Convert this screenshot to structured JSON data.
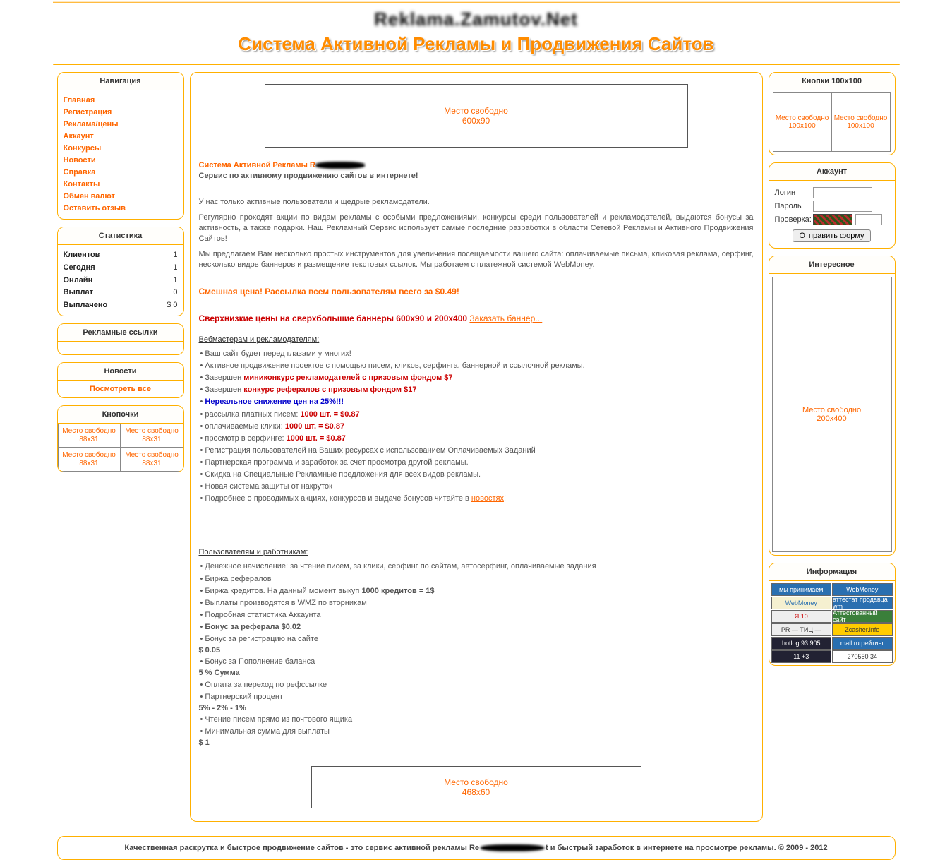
{
  "header": {
    "site_title": "Reklama.Zamutov.Net",
    "subtitle": "Система Активной Рекламы и Продвижения Сайтов"
  },
  "nav": {
    "title": "Навигация",
    "items": [
      "Главная",
      "Регистрация",
      "Реклама/цены",
      "Аккаунт",
      "Конкурсы",
      "Новости",
      "Справка",
      "Контакты",
      "Обмен валют",
      "Оставить отзыв"
    ]
  },
  "stats": {
    "title": "Статистика",
    "rows": [
      {
        "label": "Клиентов",
        "value": "1"
      },
      {
        "label": "Сегодня",
        "value": "1"
      },
      {
        "label": "Онлайн",
        "value": "1"
      },
      {
        "label": "Выплат",
        "value": "0"
      },
      {
        "label": "Выплачено",
        "value": "$ 0"
      }
    ]
  },
  "adlinks": {
    "title": "Рекламные ссылки"
  },
  "news": {
    "title": "Новости",
    "link": "Посмотреть все"
  },
  "buttons88": {
    "title": "Кнопочки",
    "slot": "Место свободно 88x31"
  },
  "banner600": {
    "line1": "Место свободно",
    "line2": "600x90"
  },
  "banner468": {
    "line1": "Место свободно",
    "line2": "468x60"
  },
  "main": {
    "intro_prefix": "Система Активной Рекламы R",
    "intro2": "Сервис по активному продвижению сайтов в интернете!",
    "para1": "У нас только активные пользователи и щедрые рекламодатели.",
    "para2": "Регулярно проходят акции по видам рекламы с особыми предложениями, конкурсы среди пользователей и рекламодателей, выдаются бонусы за активность, а также подарки. Наш Рекламный Сервис использует самые последние разработки в области Сетевой Рекламы и Активного Продвижения Сайтов!",
    "para3": "Мы предлагаем Вам несколько простых инструментов для увеличения посещаемости вашего сайта: оплачиваемые письма, кликовая реклама, серфинг, несколько видов баннеров и размещение текстовых ссылок. Мы работаем с платежной системой WebMoney.",
    "price1": "Смешная цена! Рассылка всем пользователям всего за $0.49!",
    "price2_a": "Сверхнизкие цены на сверхбольшие баннеры 600x90 и 200x400",
    "price2_link": "Заказать баннер...",
    "sect1": "Вебмастерам и рекламодателям:",
    "b1": "Ваш сайт будет перед глазами у многих!",
    "b2": "Активное продвижение проектов с помощью писем, кликов, серфинга, баннерной и ссылочной рекламы.",
    "b3_a": "Завершен ",
    "b3_b": "миниконкурс рекламодателей с призовым фондом $7",
    "b4_a": "Завершен ",
    "b4_b": "конкурс рефералов с призовым фондом $17",
    "b5": "Нереальное снижение цен на 25%!!!",
    "b6_a": "рассылка платных писем: ",
    "b6_b": "1000 шт. = $0.87",
    "b7_a": "оплачиваемые клики:   ",
    "b7_b": "1000 шт. = $0.87",
    "b8_a": "просмотр в серфинге: ",
    "b8_b": "1000 шт. = $0.87",
    "b9": "Регистрация пользователей на Ваших ресурсах с использованием Оплачиваемых Заданий",
    "b10": "Партнерская программа и заработок за счет просмотра другой рекламы.",
    "b11": "Скидка на Специальные Рекламные предложения для всех видов рекламы.",
    "b12": "Новая система защиты от накруток",
    "b13_a": "Подробнее о проводимых акциях, конкурсов и выдаче бонусов читайте в ",
    "b13_b": "новостях",
    "b13_c": "!",
    "sect2": "Пользователям и работникам:",
    "u1": "Денежное начисление: за чтение писем, за клики, серфинг по сайтам, автосерфинг, оплачиваемые задания",
    "u2": "Биржа рефералов",
    "u3_a": "Биржа кредитов. На данный момент выкуп ",
    "u3_b": "1000 кредитов = 1$",
    "u4": "Выплаты производятся в WMZ по вторникам",
    "u5": "Подробная статистика Аккаунта",
    "u6": "Бонус за реферала $0.02",
    "u7": "Бонус за регистрацию на сайте",
    "u7v": "$ 0.05",
    "u8": "Бонус за Пополнение баланса",
    "u8v": "5 % Сумма",
    "u9": "Оплата за переход по рефссылке",
    "u10": "Партнерский процент",
    "u10v": "5% - 2% - 1%",
    "u11": "Чтение писем прямо из почтового ящика",
    "u12": "Минимальная сумма для выплаты",
    "u12v": "$ 1"
  },
  "slots100": {
    "title": "Кнопки 100x100",
    "slot": "Место свободно 100x100"
  },
  "account": {
    "title": "Аккаунт",
    "login": "Логин",
    "password": "Пароль",
    "check": "Проверка:",
    "submit": "Отправить форму"
  },
  "interesting": {
    "title": "Интересное",
    "slot1": "Место свободно",
    "slot2": "200x400"
  },
  "info": {
    "title": "Информация",
    "badges": [
      {
        "t": "мы принимаем",
        "bg": "#2a6fb0"
      },
      {
        "t": "WebMoney",
        "bg": "#2a6fb0"
      },
      {
        "t": "WebMoney",
        "bg": "#f5f0d0",
        "fg": "#2a6fb0"
      },
      {
        "t": "аттестат продавца wm",
        "bg": "#2a6fb0"
      },
      {
        "t": "Я  10",
        "bg": "#eee",
        "fg": "#c00"
      },
      {
        "t": "Аттестованный сайт",
        "bg": "#3a7f3a"
      },
      {
        "t": "PR — ТИЦ —",
        "bg": "#eee",
        "fg": "#333"
      },
      {
        "t": "Zcasher.info",
        "bg": "#ffcc00",
        "fg": "#333"
      },
      {
        "t": "hotlog 93 905",
        "bg": "#223",
        "fg": "#fff"
      },
      {
        "t": "mail.ru рейтинг",
        "bg": "#2a6fb0"
      },
      {
        "t": "11 +3",
        "bg": "#223",
        "fg": "#fff"
      },
      {
        "t": "270550  34",
        "bg": "#fff",
        "fg": "#333"
      }
    ]
  },
  "footer": {
    "t1": "Качественная раскрутка и быстрое продвижение сайтов - это сервис активной рекламы Re",
    "t2": "t и быстрый заработок в интернете на просмотре рекламы. © 2009 - 2012"
  }
}
